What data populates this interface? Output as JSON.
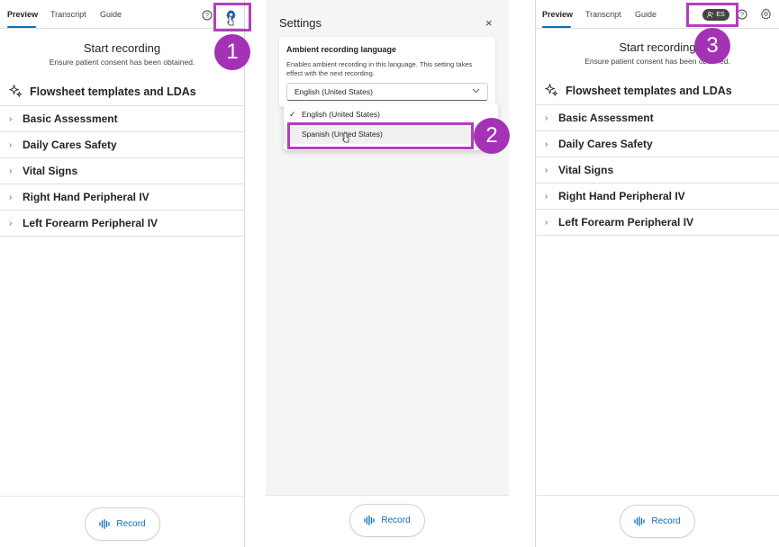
{
  "tabs": [
    {
      "label": "Preview"
    },
    {
      "label": "Transcript"
    },
    {
      "label": "Guide"
    }
  ],
  "start": {
    "title": "Start recording",
    "subtitle": "Ensure patient consent has been obtained."
  },
  "flowsheet": {
    "header": "Flowsheet templates and LDAs",
    "items": [
      {
        "label": "Basic Assessment"
      },
      {
        "label": "Daily Cares Safety"
      },
      {
        "label": "Vital Signs"
      },
      {
        "label": "Right Hand Peripheral IV"
      },
      {
        "label": "Left Forearm Peripheral IV"
      }
    ]
  },
  "record": {
    "label": "Record"
  },
  "settings": {
    "title": "Settings",
    "close": "×",
    "field_label": "Ambient recording language",
    "field_desc": "Enables ambient recording in this language. This setting takes effect with the next recording.",
    "selected_value": "English (United States)",
    "options": [
      {
        "label": "English (United States)",
        "checked": true
      },
      {
        "label": "Spanish (United States)",
        "checked": false
      }
    ]
  },
  "language_pill": {
    "code": "ES"
  },
  "callouts": [
    "1",
    "2",
    "3"
  ],
  "colors": {
    "accent": "#0f6cbd",
    "callout": "#a332b5"
  }
}
